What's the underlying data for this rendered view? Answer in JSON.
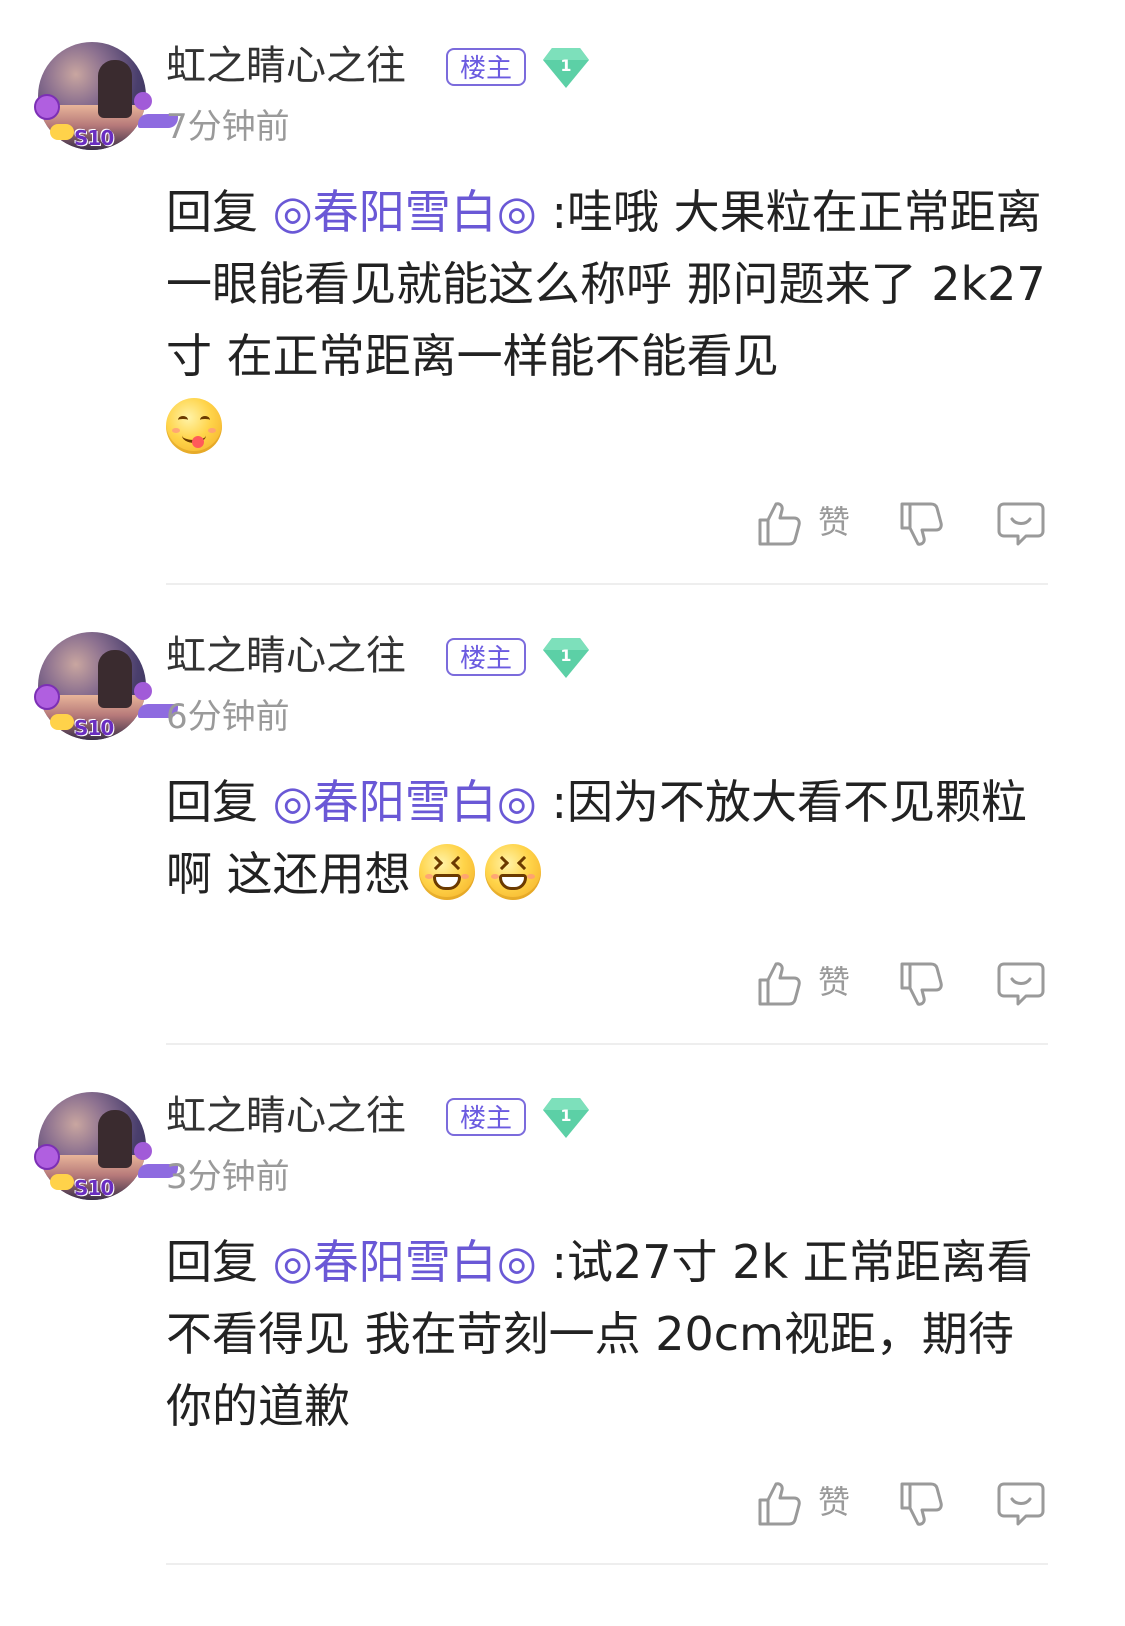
{
  "comments": [
    {
      "username": "虹之睛心之往",
      "tag": "楼主",
      "level": "1",
      "time": "7分钟前",
      "reply_prefix": "回复 ",
      "mention": "◎春阳雪白◎",
      "text": " :哇哦 大果粒在正常距离一眼能看见就能这么称呼 那问题来了 2k27寸 在正常距离一样能不能看见",
      "emojis": [
        "yum-emoji"
      ],
      "like_label": "赞"
    },
    {
      "username": "虹之睛心之往",
      "tag": "楼主",
      "level": "1",
      "time": "6分钟前",
      "reply_prefix": "回复 ",
      "mention": "◎春阳雪白◎",
      "text": " :因为不放大看不见颗粒啊 这还用想",
      "emojis": [
        "laugh-emoji",
        "laugh-emoji"
      ],
      "like_label": "赞"
    },
    {
      "username": "虹之睛心之往",
      "tag": "楼主",
      "level": "1",
      "time": "3分钟前",
      "reply_prefix": "回复 ",
      "mention": "◎春阳雪白◎",
      "text": " :试27寸 2k 正常距离看不看得见 我在苛刻一点 20cm视距，期待你的道歉",
      "emojis": [],
      "like_label": "赞"
    }
  ],
  "avatar_badge": "S10",
  "colors": {
    "mention": "#6a58d6",
    "tag_border": "#7b6bdc",
    "level_gem": "#4fc8a0",
    "muted": "#9a9a9a",
    "text": "#222222"
  },
  "icons": [
    "thumbs-up-icon",
    "thumbs-down-icon",
    "reply-bubble-icon",
    "level-gem-icon"
  ]
}
